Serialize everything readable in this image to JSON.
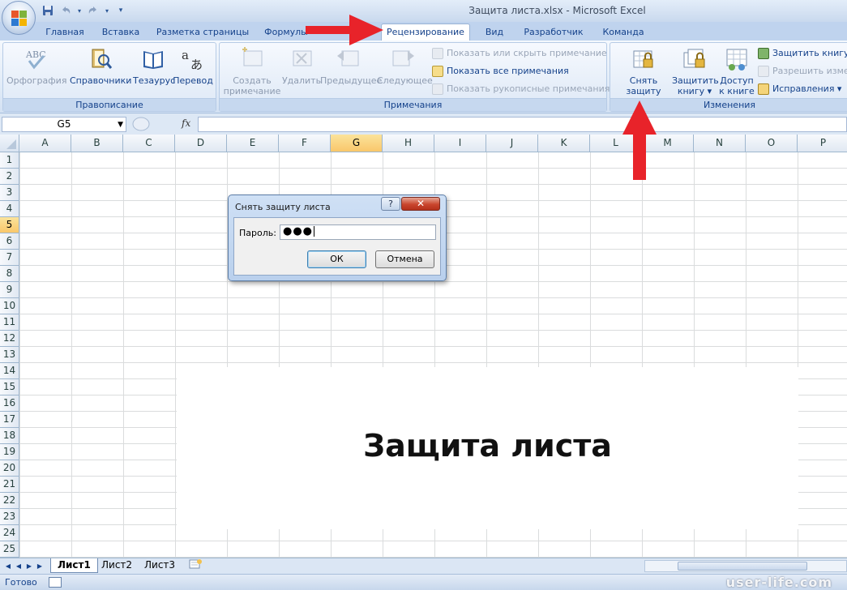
{
  "window": {
    "title": "Защита листа.xlsx - Microsoft Excel"
  },
  "qat": {
    "save_icon": "save-icon",
    "undo_icon": "undo-icon",
    "redo_icon": "redo-icon",
    "customize_icon": "customize-qat-icon"
  },
  "tabs": [
    {
      "label": "Главная"
    },
    {
      "label": "Вставка"
    },
    {
      "label": "Разметка страницы"
    },
    {
      "label": "Формулы"
    },
    {
      "label": "Рецензирование",
      "active": true
    },
    {
      "label": "Вид"
    },
    {
      "label": "Разработчик"
    },
    {
      "label": "Команда"
    }
  ],
  "ribbon": {
    "proofing": {
      "label": "Правописание",
      "spelling": "Орфография",
      "research": "Справочники",
      "thesaurus": "Тезаурус",
      "translate": "Перевод"
    },
    "comments": {
      "label": "Примечания",
      "new_line1": "Создать",
      "new_line2": "примечание",
      "delete": "Удалить",
      "previous": "Предыдущее",
      "next": "Следующее",
      "show_hide": "Показать или скрыть примечание",
      "show_all": "Показать все примечания",
      "show_ink": "Показать рукописные примечания"
    },
    "changes": {
      "label": "Изменения",
      "unprotect_line1": "Снять",
      "unprotect_line2": "защиту листа",
      "protect_wb_line1": "Защитить",
      "protect_wb_line2": "книгу ▾",
      "share_line1": "Доступ",
      "share_line2": "к книге",
      "protect_share": "Защитить книгу и",
      "allow_edit": "Разрешить измен",
      "track": "Исправления ▾"
    }
  },
  "formula_bar": {
    "name_box": "G5",
    "fx": "fx",
    "value": ""
  },
  "grid": {
    "columns": [
      "A",
      "B",
      "C",
      "D",
      "E",
      "F",
      "G",
      "H",
      "I",
      "J",
      "K",
      "L",
      "M",
      "N",
      "O",
      "P"
    ],
    "selected_column": "G",
    "rows": [
      "1",
      "2",
      "3",
      "4",
      "5",
      "6",
      "7",
      "8",
      "9",
      "10",
      "11",
      "12",
      "13",
      "14",
      "15",
      "16",
      "17",
      "18",
      "19",
      "20",
      "21",
      "22",
      "23",
      "24",
      "25"
    ],
    "selected_row": "5"
  },
  "overlay_text": "Защита листа",
  "dialog": {
    "title": "Снять защиту листа",
    "help": "?",
    "close": "✕",
    "password_label": "Пароль:",
    "password_value": "●●●",
    "ok": "ОК",
    "cancel": "Отмена"
  },
  "sheets": [
    {
      "name": "Лист1",
      "active": true
    },
    {
      "name": "Лист2"
    },
    {
      "name": "Лист3"
    }
  ],
  "status": {
    "text": "Готово"
  },
  "watermark": "user-life.com",
  "colors": {
    "arrow": "#e8232a",
    "selection": "#f9c76b",
    "ribbon_text": "#15428b"
  }
}
